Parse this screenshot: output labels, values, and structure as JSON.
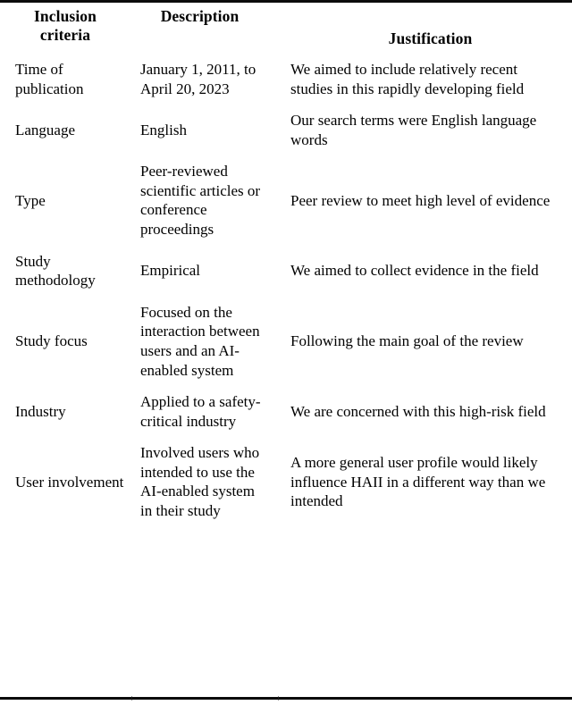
{
  "table": {
    "caption_present": false,
    "columns": [
      {
        "key": "criteria",
        "header": "Inclusion criteria"
      },
      {
        "key": "description",
        "header": "Description"
      },
      {
        "key": "justification",
        "header": "Justification"
      }
    ],
    "rows": [
      {
        "criteria": "Time of publication",
        "description": "January 1, 2011, to April 20, 2023",
        "justification": "We aimed to include relatively recent studies in this rapidly developing field"
      },
      {
        "criteria": "Language",
        "description": "English",
        "justification": "Our search terms were English language words"
      },
      {
        "criteria": "Type",
        "description": "Peer-reviewed scientific articles or conference proceedings",
        "justification": "Peer review to meet high level of evidence"
      },
      {
        "criteria": "Study methodology",
        "description": "Empirical",
        "justification": "We aimed to collect evidence in the field"
      },
      {
        "criteria": "Study focus",
        "description": "Focused on the interaction between users and an AI-enabled system",
        "justification": "Following the main goal of the review"
      },
      {
        "criteria": "Industry",
        "description": "Applied to a safety-critical industry",
        "justification": "We are concerned with this high-risk field"
      },
      {
        "criteria": "User involvement",
        "description": "Involved users who intended to use the AI-enabled system in their study",
        "justification": "A more general user profile would likely influence HAII in a different way than we intended"
      }
    ]
  },
  "style": {
    "text_color": "#000000",
    "rule_color": "#0b0b0b",
    "background": "#ffffff"
  }
}
